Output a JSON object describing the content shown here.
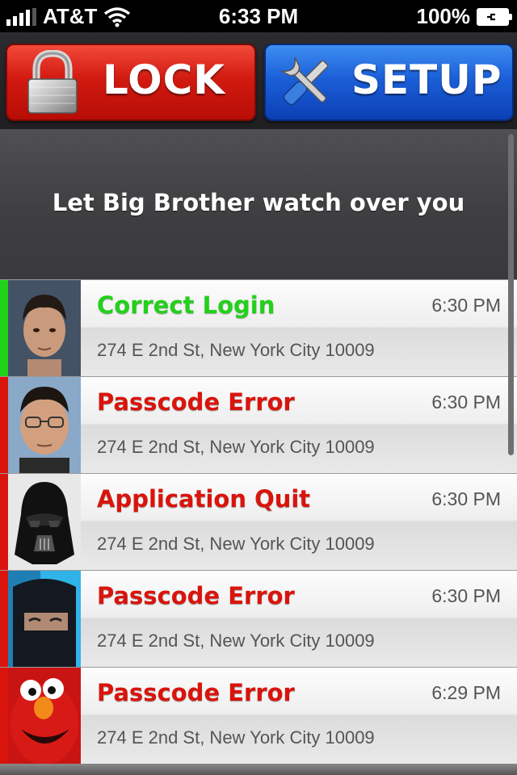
{
  "status_bar": {
    "carrier": "AT&T",
    "time": "6:33 PM",
    "battery": "100%"
  },
  "buttons": {
    "lock_label": "LOCK",
    "setup_label": "SETUP",
    "lock_icon": "padlock-icon",
    "setup_icon": "wrench-screwdriver-icon"
  },
  "tagline": "Let Big Brother watch over you",
  "colors": {
    "success": "#22d11a",
    "error": "#d9140c",
    "lock_button": "#d21a10",
    "setup_button": "#1b5fd8"
  },
  "events": [
    {
      "title": "Correct Login",
      "status": "success",
      "time": "6:30 PM",
      "address": "274 E 2nd St, New York City 10009",
      "avatar": "man-face-photo"
    },
    {
      "title": "Passcode Error",
      "status": "error",
      "time": "6:30 PM",
      "address": "274 E 2nd St, New York City 10009",
      "avatar": "man-glasses-photo"
    },
    {
      "title": "Application Quit",
      "status": "error",
      "time": "6:30 PM",
      "address": "274 E 2nd St, New York City 10009",
      "avatar": "darth-vader-mask-photo"
    },
    {
      "title": "Passcode Error",
      "status": "error",
      "time": "6:30 PM",
      "address": "274 E 2nd St, New York City 10009",
      "avatar": "ninja-mask-photo"
    },
    {
      "title": "Passcode Error",
      "status": "error",
      "time": "6:29 PM",
      "address": "274 E 2nd St, New York City 10009",
      "avatar": "elmo-photo"
    }
  ]
}
